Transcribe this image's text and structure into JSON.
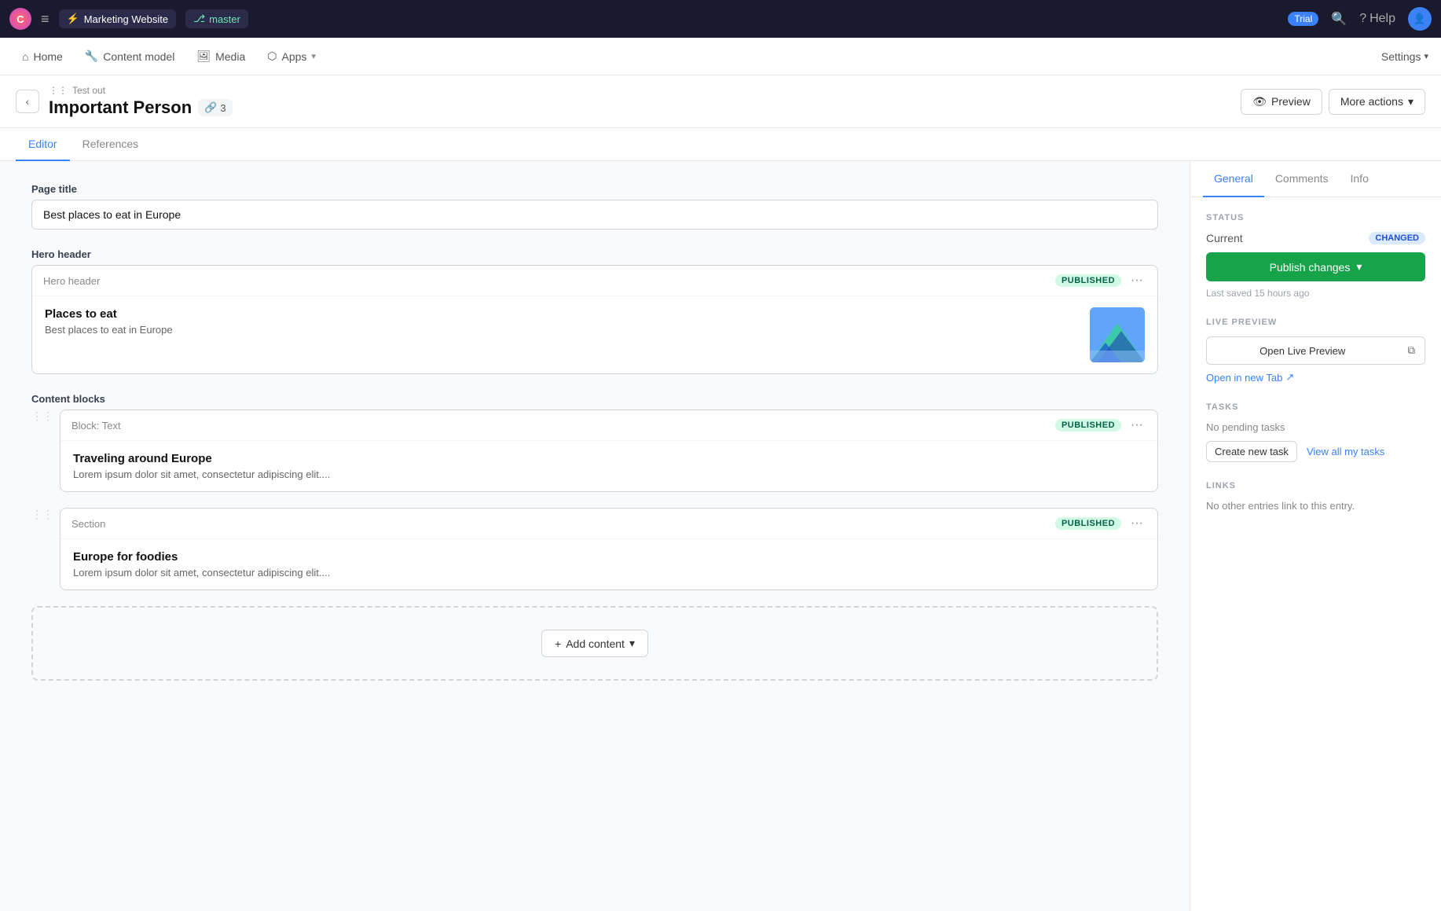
{
  "topNav": {
    "logo": "C",
    "projectName": "Marketing Website",
    "branchName": "master",
    "trialLabel": "Trial",
    "helpLabel": "Help",
    "menuIcon": "≡"
  },
  "secondNav": {
    "items": [
      {
        "id": "home",
        "label": "Home",
        "icon": "⌂"
      },
      {
        "id": "content-model",
        "label": "Content model",
        "icon": "🔧"
      },
      {
        "id": "media",
        "label": "Media",
        "icon": "🖼"
      },
      {
        "id": "apps",
        "label": "Apps",
        "icon": "⬡"
      }
    ],
    "settingsLabel": "Settings"
  },
  "entryHeader": {
    "breadcrumb": "Test out",
    "title": "Important Person",
    "refCount": "3",
    "previewLabel": "Preview",
    "moreActionsLabel": "More actions"
  },
  "tabs": {
    "editor": "Editor",
    "references": "References",
    "activeTab": "editor"
  },
  "editor": {
    "pageTitle": {
      "label": "Page title",
      "value": "Best places to eat in Europe"
    },
    "heroHeader": {
      "label": "Hero header",
      "blockName": "Hero header",
      "status": "PUBLISHED",
      "title": "Places to eat",
      "description": "Best places to eat in Europe"
    },
    "contentBlocks": {
      "label": "Content blocks",
      "blocks": [
        {
          "id": "block-text",
          "name": "Block: Text",
          "status": "PUBLISHED",
          "title": "Traveling around Europe",
          "description": "Lorem ipsum dolor sit amet, consectetur adipiscing elit...."
        },
        {
          "id": "section",
          "name": "Section",
          "status": "PUBLISHED",
          "title": "Europe for foodies",
          "description": "Lorem ipsum dolor sit amet, consectetur adipiscing elit...."
        }
      ]
    },
    "addContentLabel": "+ Add content"
  },
  "sidebar": {
    "tabs": [
      {
        "id": "general",
        "label": "General"
      },
      {
        "id": "comments",
        "label": "Comments"
      },
      {
        "id": "info",
        "label": "Info"
      }
    ],
    "activeTab": "general",
    "status": {
      "sectionTitle": "STATUS",
      "currentLabel": "Current",
      "changedBadge": "CHANGED",
      "publishChangesLabel": "Publish changes",
      "lastSaved": "Last saved 15 hours ago"
    },
    "livePreview": {
      "sectionTitle": "LIVE PREVIEW",
      "openLabel": "Open Live Preview",
      "openInTabLabel": "Open in new Tab"
    },
    "tasks": {
      "sectionTitle": "TASKS",
      "noPendingLabel": "No pending tasks",
      "createNewTaskLabel": "Create new task",
      "viewAllLabel": "View all my tasks"
    },
    "links": {
      "sectionTitle": "LINKS",
      "noLinksLabel": "No other entries link to this entry."
    }
  }
}
